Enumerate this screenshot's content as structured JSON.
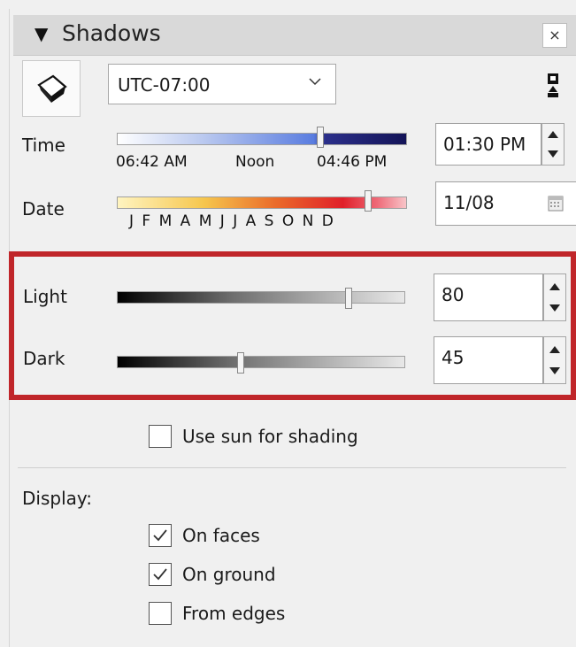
{
  "panel": {
    "title": "Shadows",
    "close_label": "×"
  },
  "icons": {
    "collapse": "triangle-down-icon",
    "shadow_toggle": "shadow-cube-icon",
    "dropdown": "chevron-down-icon",
    "pin": "pin-icon",
    "calendar": "calendar-icon"
  },
  "timezone": {
    "value": "UTC-07:00"
  },
  "time": {
    "label": "Time",
    "sunrise": "06:42 AM",
    "noon": "Noon",
    "sunset": "04:46 PM",
    "value": "01:30 PM",
    "slider_fraction": 0.72
  },
  "date": {
    "label": "Date",
    "months": "J F M A M J J A S O N D",
    "value": "11/08",
    "slider_fraction": 0.86
  },
  "light": {
    "label": "Light",
    "value": "80"
  },
  "dark": {
    "label": "Dark",
    "value": "45"
  },
  "use_sun": {
    "label": "Use sun for shading",
    "checked": false
  },
  "display": {
    "label": "Display:",
    "options": [
      {
        "label": "On faces",
        "checked": true
      },
      {
        "label": "On ground",
        "checked": true
      },
      {
        "label": "From edges",
        "checked": false
      }
    ]
  },
  "colors": {
    "highlight": "#c0262a",
    "time_day": "#5a7de0",
    "time_night": "#1a1a5c"
  }
}
